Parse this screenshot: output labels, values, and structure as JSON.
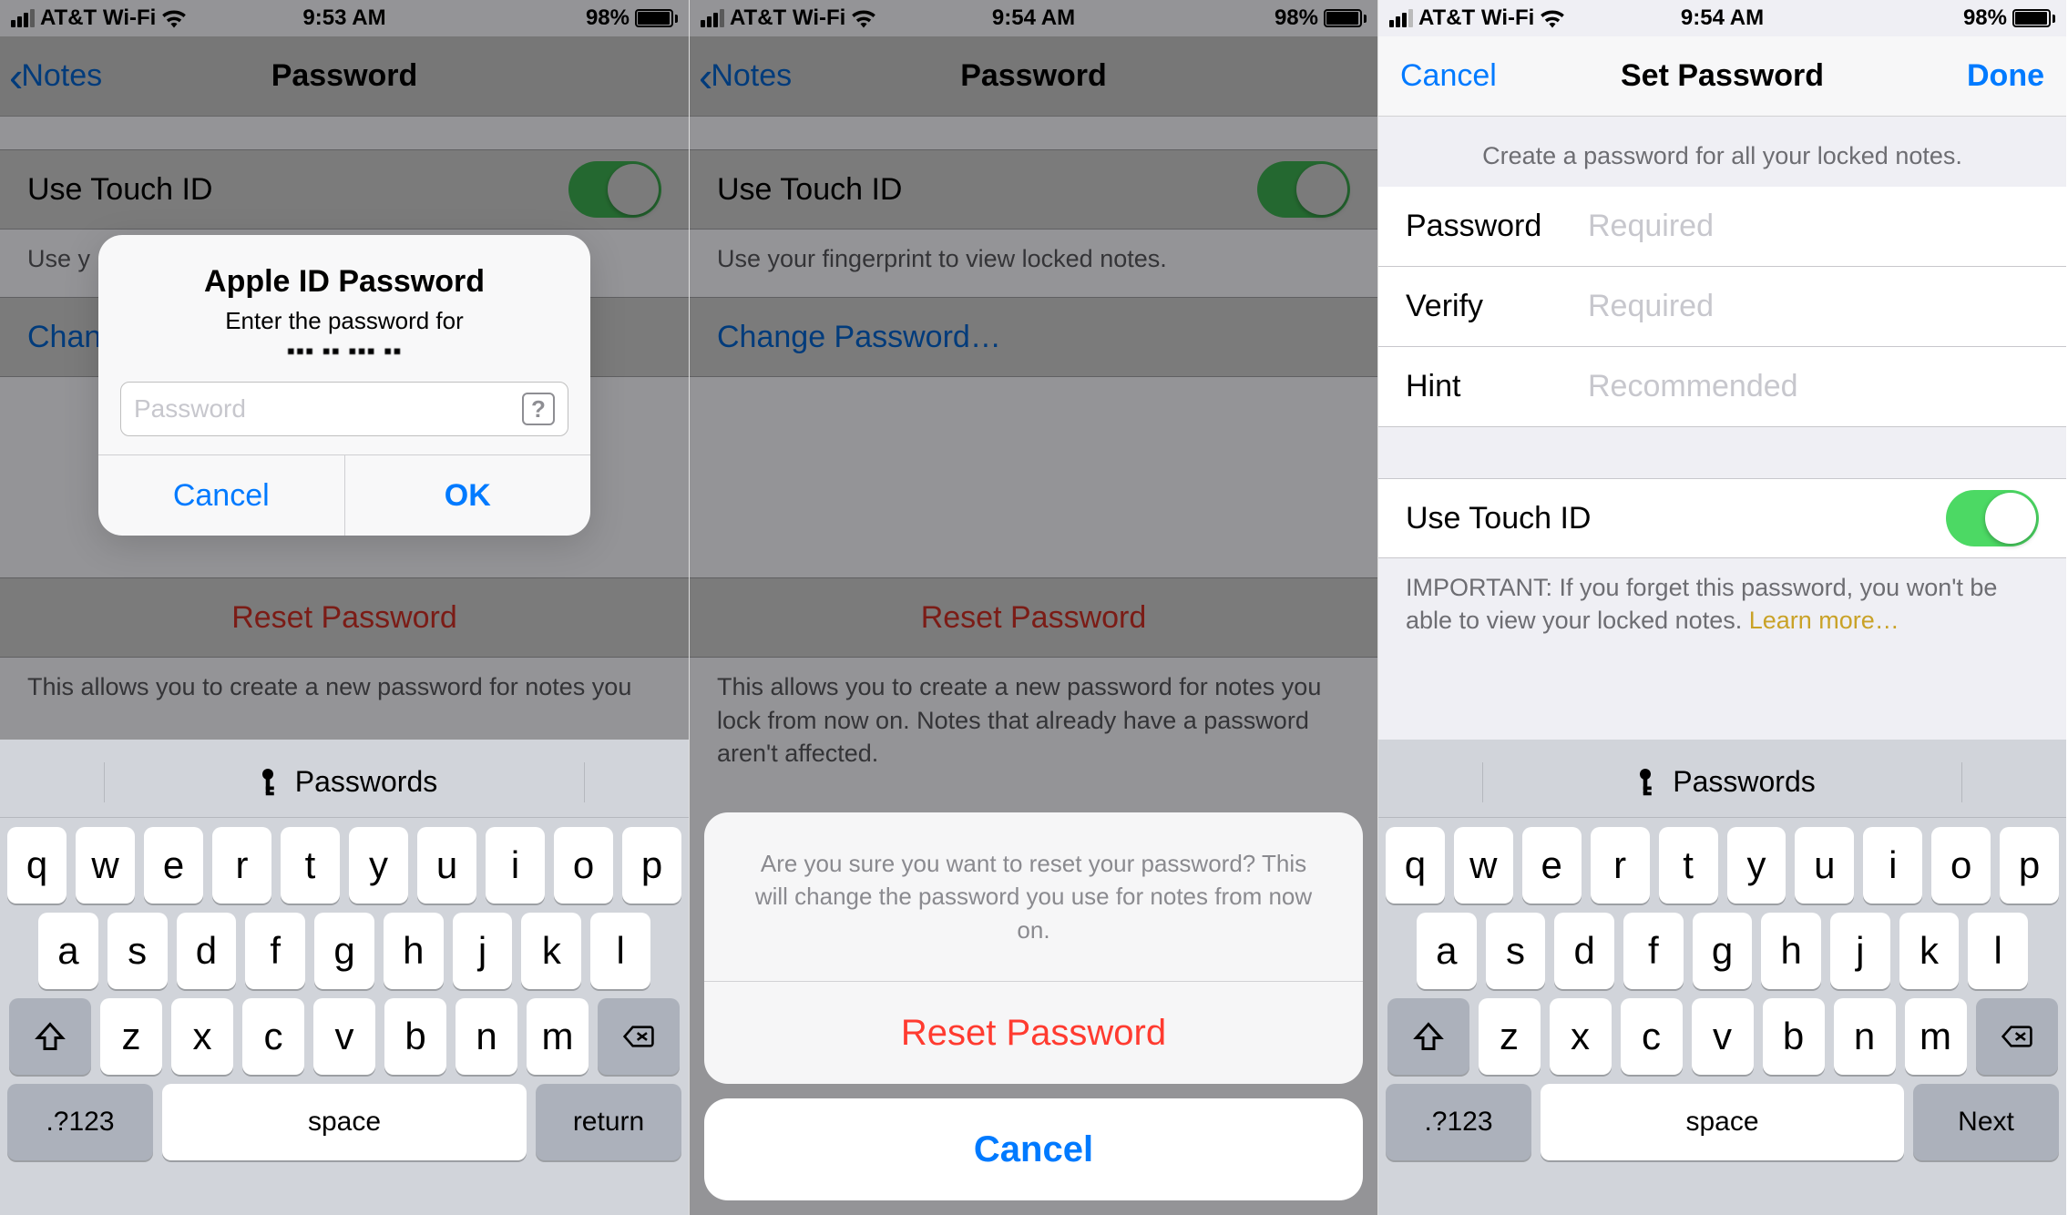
{
  "status": {
    "carrier": "AT&T Wi-Fi",
    "battery_pct": "98%"
  },
  "times": {
    "s1": "9:53 AM",
    "s2": "9:54 AM",
    "s3": "9:54 AM"
  },
  "screen1": {
    "back": "Notes",
    "title": "Password",
    "touchid": "Use Touch ID",
    "touchid_hint_trunc": "Use y",
    "change": "Change Password…",
    "change_trunc": "Chan",
    "reset": "Reset Password",
    "reset_hint": "This allows you to create a new password for notes you",
    "alert": {
      "title": "Apple ID Password",
      "msg": "Enter the password for",
      "redacted": "▪▪▪ ▪▪ ▪▪▪ ▪▪",
      "placeholder": "Password",
      "cancel": "Cancel",
      "ok": "OK"
    }
  },
  "screen2": {
    "back": "Notes",
    "title": "Password",
    "touchid": "Use Touch ID",
    "touchid_hint": "Use your fingerprint to view locked notes.",
    "change": "Change Password…",
    "reset": "Reset Password",
    "reset_hint": "This allows you to create a new password for notes you lock from now on. Notes that already have a password aren't affected.",
    "sheet": {
      "msg": "Are you sure you want to reset your password? This will change the password you use for notes from now on.",
      "action": "Reset Password",
      "cancel": "Cancel"
    }
  },
  "screen3": {
    "cancel": "Cancel",
    "done": "Done",
    "title": "Set Password",
    "header": "Create a password for all your locked notes.",
    "fields": {
      "password": {
        "label": "Password",
        "ph": "Required"
      },
      "verify": {
        "label": "Verify",
        "ph": "Required"
      },
      "hint": {
        "label": "Hint",
        "ph": "Recommended"
      }
    },
    "touchid": "Use Touch ID",
    "important": "IMPORTANT: If you forget this password, you won't be able to view your locked notes. ",
    "learn": "Learn more…"
  },
  "keyboard": {
    "suggestion": "Passwords",
    "r1": [
      "q",
      "w",
      "e",
      "r",
      "t",
      "y",
      "u",
      "i",
      "o",
      "p"
    ],
    "r2": [
      "a",
      "s",
      "d",
      "f",
      "g",
      "h",
      "j",
      "k",
      "l"
    ],
    "r3": [
      "z",
      "x",
      "c",
      "v",
      "b",
      "n",
      "m"
    ],
    "num": ".?123",
    "space": "space",
    "return": "return",
    "next": "Next"
  }
}
